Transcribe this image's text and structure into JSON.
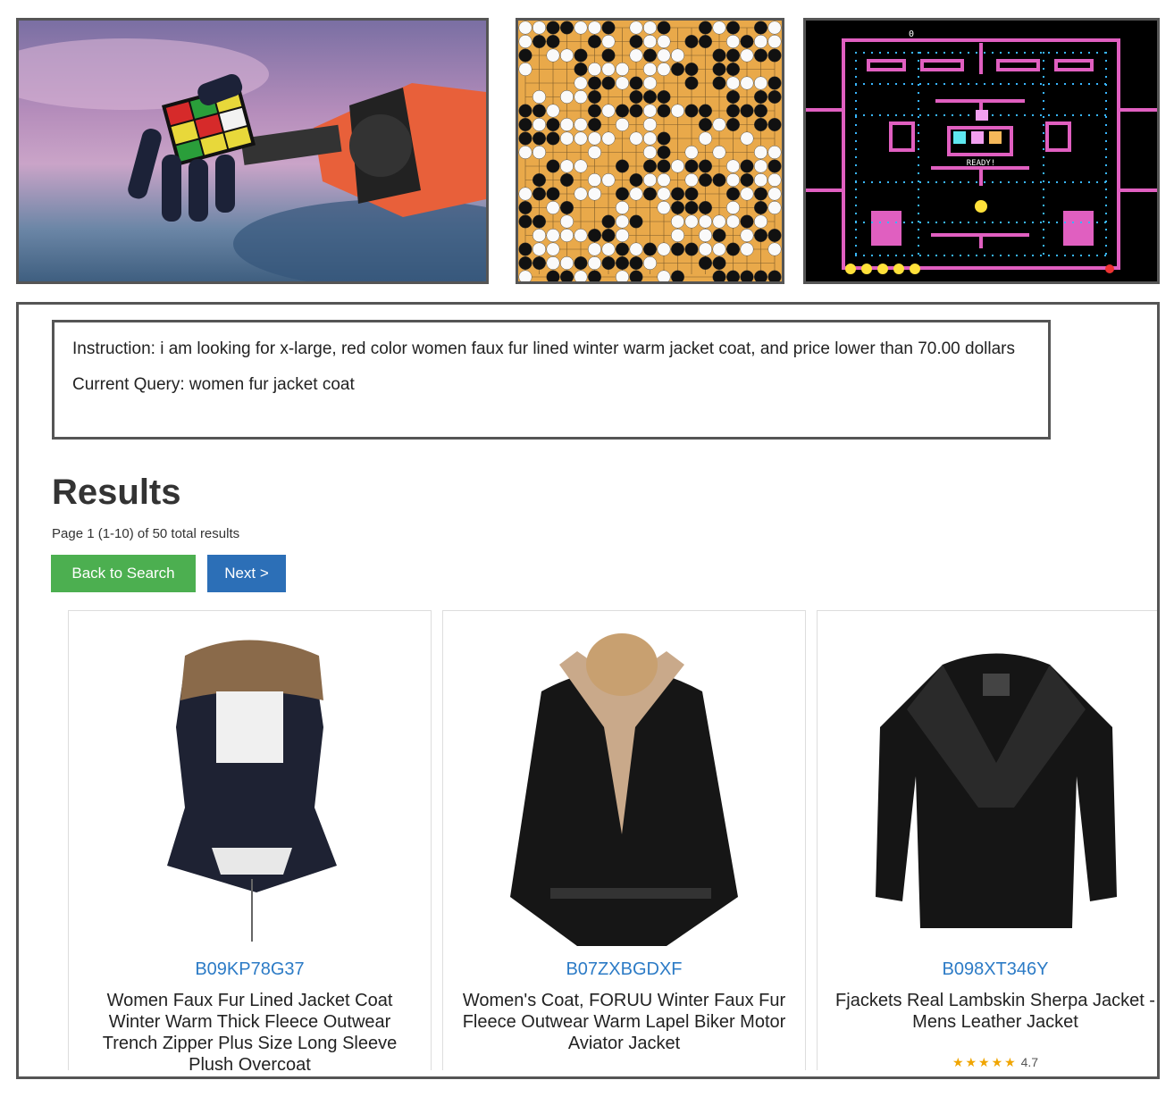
{
  "pacman": {
    "score": "0",
    "ready_text": "READY!"
  },
  "instruction_box": {
    "instruction": "Instruction: i am looking for x-large, red color women faux fur lined winter warm jacket coat, and price lower than 70.00 dollars",
    "query": "Current Query: women fur jacket coat"
  },
  "results": {
    "title": "Results",
    "page_info": "Page 1 (1-10) of 50 total results",
    "back_button": "Back to Search",
    "next_button": "Next >"
  },
  "products": [
    {
      "asin": "B09KP78G37",
      "name": "Women Faux Fur Lined Jacket Coat Winter Warm Thick Fleece Outwear Trench Zipper Plus Size Long Sleeve Plush Overcoat"
    },
    {
      "asin": "B07ZXBGDXF",
      "name": "Women's Coat, FORUU Winter Faux Fur Fleece Outwear Warm Lapel Biker Motor Aviator Jacket"
    },
    {
      "asin": "B098XT346Y",
      "name": "Fjackets Real Lambskin Sherpa Jacket - Mens Leather Jacket",
      "stars": "★★★★★",
      "rating": "4.7"
    }
  ],
  "colors": {
    "go_board": "#e9a94a",
    "maze_wall": "#e05fc0",
    "pellet": "#38b6ff",
    "link": "#2c7bc6",
    "green_button": "#4caf50",
    "blue_button": "#2c6fb7"
  }
}
